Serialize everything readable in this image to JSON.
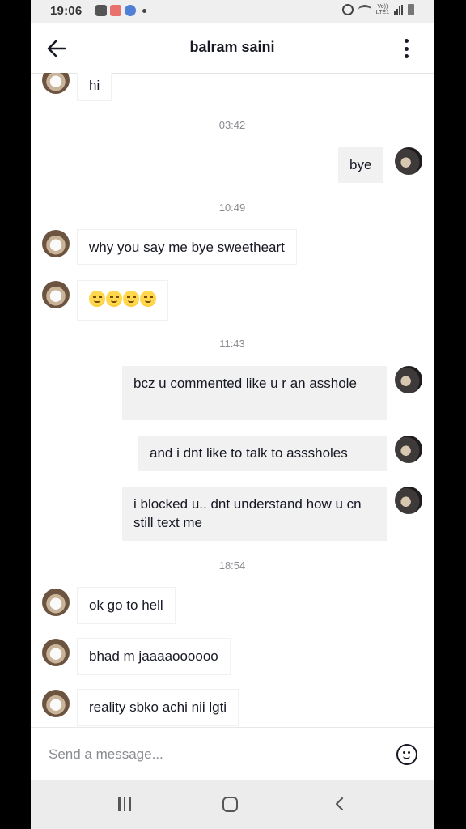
{
  "status_bar": {
    "time": "19:06",
    "network_label": "Vo))\nLTE1"
  },
  "header": {
    "title": "balram saini"
  },
  "messages": [
    {
      "type": "text",
      "from": "other",
      "text": "hi"
    },
    {
      "type": "time",
      "text": "03:42"
    },
    {
      "type": "text",
      "from": "me",
      "text": "bye"
    },
    {
      "type": "time",
      "text": "10:49"
    },
    {
      "type": "text",
      "from": "other",
      "text": "why you say me bye sweetheart"
    },
    {
      "type": "emoji",
      "from": "other",
      "emoji_name": "smirking-face",
      "count": 4
    },
    {
      "type": "time",
      "text": "11:43"
    },
    {
      "type": "text",
      "from": "me",
      "text": "bcz u commented like u r an asshole"
    },
    {
      "type": "text",
      "from": "me",
      "text": "and i dnt like to talk to asssholes"
    },
    {
      "type": "text",
      "from": "me",
      "text": "i blocked u.. dnt understand how u cn still text me"
    },
    {
      "type": "time",
      "text": "18:54"
    },
    {
      "type": "text",
      "from": "other",
      "text": "ok go to hell"
    },
    {
      "type": "text",
      "from": "other",
      "text": "bhad m jaaaaoooooo"
    },
    {
      "type": "text",
      "from": "other",
      "text": "reality sbko achi nii lgti"
    }
  ],
  "composer": {
    "placeholder": "Send a message..."
  },
  "icons": {
    "back": "back-arrow-icon",
    "more": "more-vertical-icon",
    "emoji": "emoji-icon",
    "nav_recent": "recent-apps-icon",
    "nav_home": "home-icon",
    "nav_back": "nav-back-icon"
  }
}
